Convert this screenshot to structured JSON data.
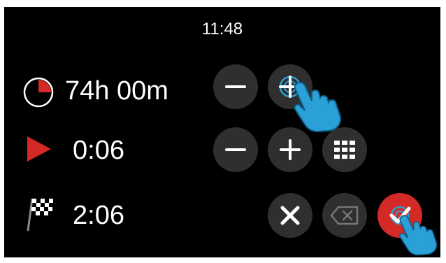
{
  "status_bar": {
    "time": "11:48"
  },
  "rows": {
    "duration": {
      "icon": "timer-pie-icon",
      "value": "74h 00m"
    },
    "start_delay": {
      "icon": "play-icon",
      "value": "0:06"
    },
    "end_time": {
      "icon": "checkered-flag-icon",
      "value": "2:06"
    }
  },
  "buttons": {
    "duration_decrement": {
      "icon": "minus-icon"
    },
    "duration_target": {
      "icon": "crosshair-icon"
    },
    "delay_decrement": {
      "icon": "minus-icon"
    },
    "delay_increment": {
      "icon": "plus-icon"
    },
    "keypad": {
      "icon": "keypad-grid-icon"
    },
    "cancel": {
      "icon": "close-icon"
    },
    "backspace": {
      "icon": "backspace-icon"
    },
    "confirm": {
      "icon": "checkmark-icon",
      "color": "#d32a28"
    }
  },
  "colors": {
    "accent_red": "#d32a28",
    "button_gray": "#2f2f2f",
    "hand_blue": "#2aa0d6"
  }
}
